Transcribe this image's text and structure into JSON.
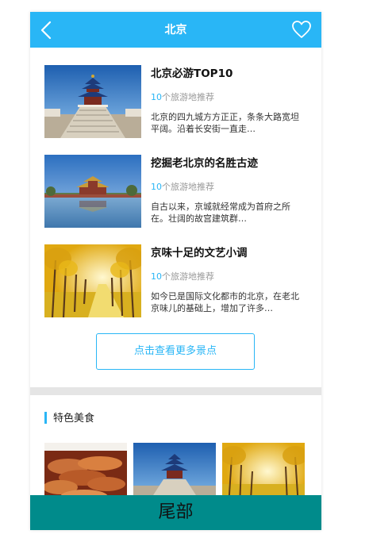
{
  "header": {
    "title": "北京",
    "back_icon": "chevron-left-icon",
    "favorite_icon": "heart-outline-icon",
    "color": "#29b6f6"
  },
  "attractions": [
    {
      "title": "北京必游TOP10",
      "count_num": "10",
      "count_text": "个旅游地推荐",
      "desc": "北京的四九城方方正正，条条大路宽坦平阔。沿着长安街一直走…",
      "image": "temple-of-heaven-photo"
    },
    {
      "title": "挖掘老北京的名胜古迹",
      "count_num": "10",
      "count_text": "个旅游地推荐",
      "desc": "自古以来，京城就经常成为首府之所在。壮阔的故宫建筑群…",
      "image": "forbidden-city-moat-photo"
    },
    {
      "title": "京味十足的文艺小调",
      "count_num": "10",
      "count_text": "个旅游地推荐",
      "desc": "如今已是国际文化都市的北京，在老北京味儿的基础上，增加了许多…",
      "image": "ginkgo-avenue-photo"
    }
  ],
  "more_button": "点击查看更多景点",
  "food_section": {
    "title": "特色美食",
    "images": [
      "roast-food-photo",
      "temple-of-heaven-photo",
      "ginkgo-avenue-photo"
    ]
  },
  "footer": {
    "label": "尾部",
    "color": "#008b8b"
  }
}
